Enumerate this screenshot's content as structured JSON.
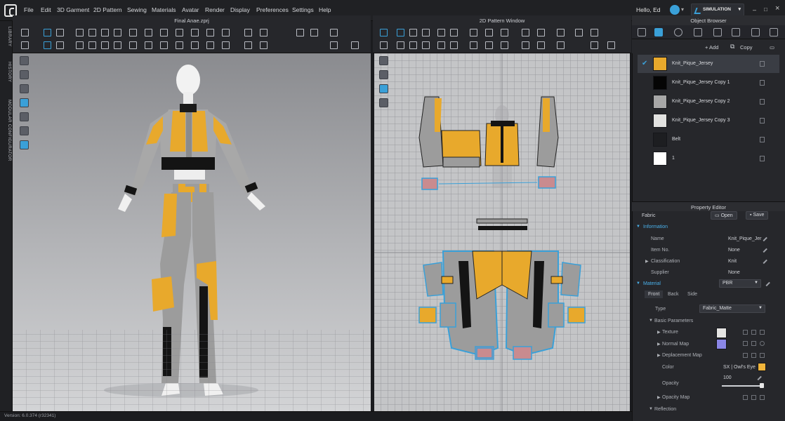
{
  "menu": {
    "items": [
      "File",
      "Edit",
      "3D Garment",
      "2D Pattern",
      "Sewing",
      "Materials",
      "Avatar",
      "Render",
      "Display",
      "Preferences",
      "Settings",
      "Help"
    ],
    "greeting": "Hello, Ed",
    "mode": "SIMULATION",
    "window_controls": [
      "–",
      "□",
      "×"
    ]
  },
  "left_tabs": [
    "LIBRARY",
    "HISTORY",
    "MODULAR CONFIGURATOR"
  ],
  "window3d": {
    "title": "Final Anae.zprj"
  },
  "window2d": {
    "title": "2D Pattern Window"
  },
  "status": {
    "version": "Version: 6.0.374 (r32341)"
  },
  "object_browser": {
    "title": "Object Browser",
    "add_label": "+ Add",
    "copy_label": "Copy",
    "fabrics": [
      {
        "name": "Knit_Pique_Jersey",
        "color": "#e8a92c",
        "selected": true
      },
      {
        "name": "Knit_Pique_Jersey Copy 1",
        "color": "#050505",
        "selected": false
      },
      {
        "name": "Knit_Pique_Jersey Copy 2",
        "color": "#a7a7a7",
        "selected": false
      },
      {
        "name": "Knit_Pique_Jersey Copy 3",
        "color": "#e2e2e0",
        "selected": false
      },
      {
        "name": "Belt",
        "color": "#1d1e21",
        "selected": false
      },
      {
        "name": "1",
        "color": "#ffffff",
        "selected": false
      }
    ]
  },
  "property_editor": {
    "title": "Property Editor",
    "fabric_label": "Fabric",
    "open_label": "Open",
    "save_label": "Save",
    "information": {
      "section": "Information",
      "name_label": "Name",
      "name_value": "Knit_Pique_Jer",
      "item_no_label": "Item No.",
      "item_no_value": "None",
      "classification_label": "Classification",
      "classification_value": "Knit",
      "supplier_label": "Supplier",
      "supplier_value": "None"
    },
    "material": {
      "section": "Material",
      "value": "PBR",
      "tabs": [
        "Front",
        "Back",
        "Side"
      ],
      "type_label": "Type",
      "type_value": "Fabric_Matte",
      "basic_parameters": "Basic Parameters",
      "texture_label": "Texture",
      "normal_map_label": "Normal Map",
      "displacement_map_label": "Deplacement Map",
      "color_label": "Color",
      "color_value": "SX | Owl's Eye",
      "opacity_label": "Opacity",
      "opacity_value": "100",
      "opacity_map_label": "Opacity Map",
      "reflection_label": "Reflection"
    },
    "colors": {
      "texture": "#e4e4e2",
      "normal_map": "#8a86e6",
      "color": "#f0b43a"
    }
  },
  "colors": {
    "accent": "#3aa0d8",
    "garment_yellow": "#e8a92c",
    "garment_grey": "#9c9c9c"
  }
}
